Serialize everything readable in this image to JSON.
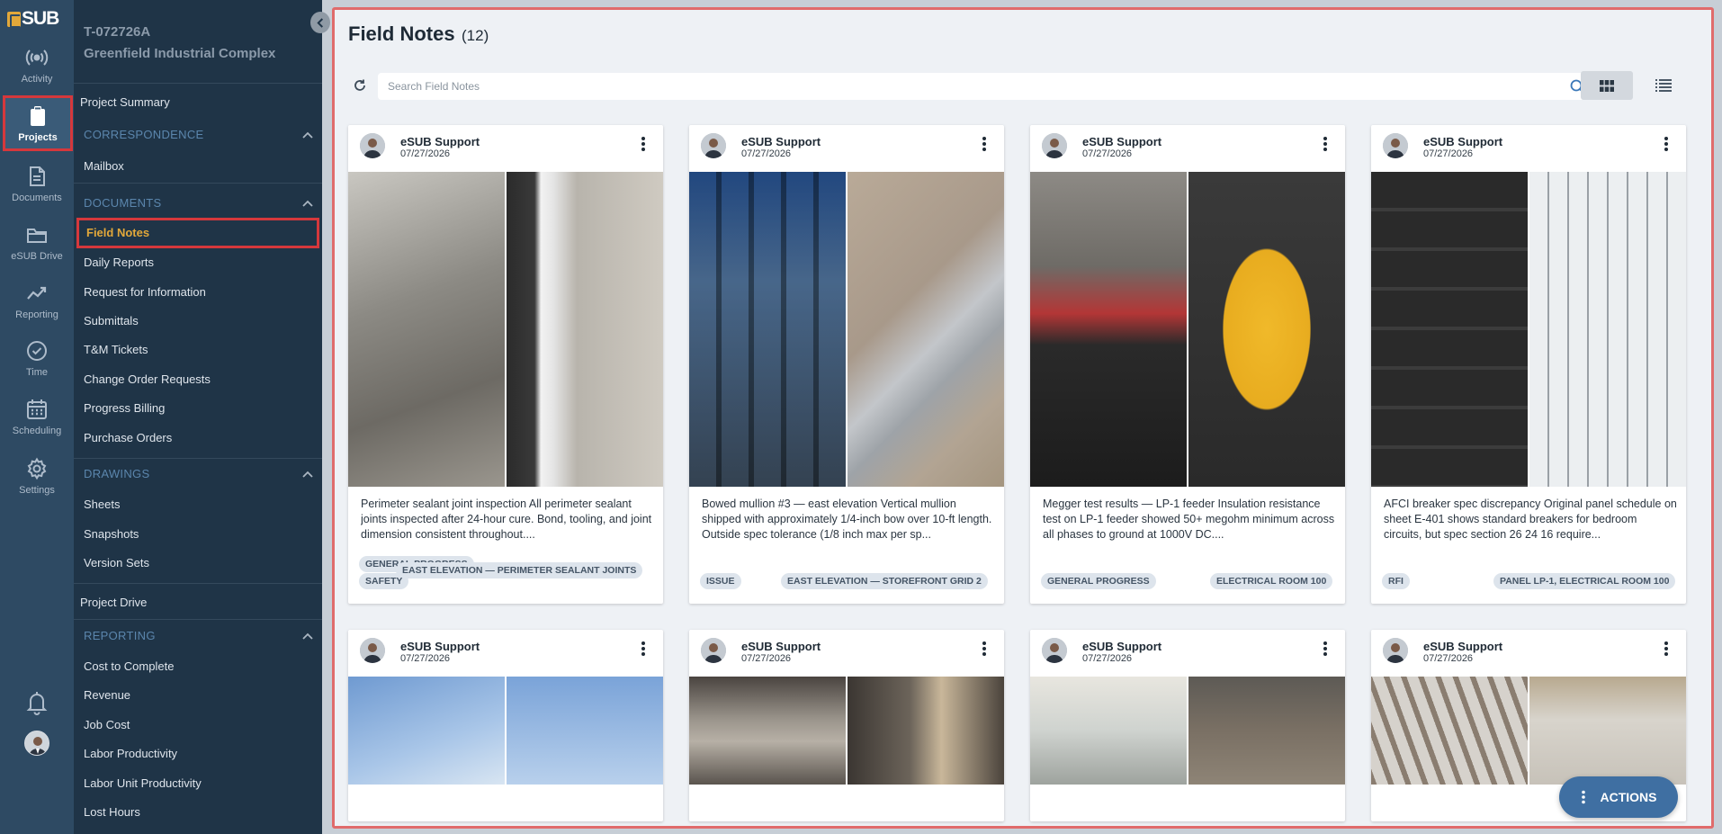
{
  "brand": {
    "logo_text": "SUB"
  },
  "rail": [
    {
      "label": "Activity",
      "icon": "activity-icon"
    },
    {
      "label": "Projects",
      "icon": "clipboard-icon",
      "active": true
    },
    {
      "label": "Documents",
      "icon": "document-icon"
    },
    {
      "label": "eSUB Drive",
      "icon": "folder-icon"
    },
    {
      "label": "Reporting",
      "icon": "trend-icon"
    },
    {
      "label": "Time",
      "icon": "clock-check-icon"
    },
    {
      "label": "Scheduling",
      "icon": "calendar-icon"
    },
    {
      "label": "Settings",
      "icon": "gear-icon"
    }
  ],
  "project": {
    "code": "T-072726A",
    "name": "Greenfield Industrial Complex"
  },
  "nav": {
    "project_summary": "Project Summary",
    "correspondence": {
      "header": "CORRESPONDENCE",
      "items": [
        "Mailbox"
      ]
    },
    "documents": {
      "header": "DOCUMENTS",
      "items": [
        "Field Notes",
        "Daily Reports",
        "Request for Information",
        "Submittals",
        "T&M Tickets",
        "Change Order Requests",
        "Progress Billing",
        "Purchase Orders"
      ],
      "active": "Field Notes"
    },
    "drawings": {
      "header": "DRAWINGS",
      "items": [
        "Sheets",
        "Snapshots",
        "Version Sets"
      ]
    },
    "project_drive": "Project Drive",
    "reporting": {
      "header": "REPORTING",
      "items": [
        "Cost to Complete",
        "Revenue",
        "Job Cost",
        "Labor Productivity",
        "Labor Unit Productivity",
        "Lost Hours"
      ]
    }
  },
  "main": {
    "title": "Field Notes",
    "count": "(12)",
    "search_placeholder": "Search Field Notes",
    "actions_label": "ACTIONS",
    "view_mode": "grid"
  },
  "cards": [
    {
      "author": "eSUB Support",
      "date": "07/27/2026",
      "description": "Perimeter sealant joint inspection All perimeter sealant joints inspected after 24-hour cure. Bond, tooling, and joint dimension consistent throughout....",
      "tags": [
        "GENERAL PROGRESS",
        "EAST ELEVATION — PERIMETER SEALANT JOINTS",
        "SAFETY"
      ],
      "photos": [
        "sealant-caulk-gun",
        "sealant-joint-frame"
      ]
    },
    {
      "author": "eSUB Support",
      "date": "07/27/2026",
      "description": "Bowed mullion #3 — east elevation Vertical mullion shipped with approximately 1/4-inch bow over 10-ft length. Outside spec tolerance (1/8 inch max per sp...",
      "tags": [
        "ISSUE",
        "EAST ELEVATION — STOREFRONT GRID 2"
      ],
      "photos": [
        "storefront-framing",
        "aluminum-mullion"
      ]
    },
    {
      "author": "eSUB Support",
      "date": "07/27/2026",
      "description": "Megger test results — LP-1 feeder Insulation resistance test on LP-1 feeder showed 50+ megohm minimum across all phases to ground at 1000V DC....",
      "tags": [
        "GENERAL PROGRESS",
        "ELECTRICAL ROOM 100"
      ],
      "photos": [
        "feeder-lugs",
        "megger-meter"
      ]
    },
    {
      "author": "eSUB Support",
      "date": "07/27/2026",
      "description": "AFCI breaker spec discrepancy Original panel schedule on sheet E-401 shows standard breakers for bedroom circuits, but spec section 26 24 16 require...",
      "tags": [
        "RFI",
        "PANEL LP-1, ELECTRICAL ROOM 100"
      ],
      "photos": [
        "breaker-panel",
        "afci-breakers"
      ]
    },
    {
      "author": "eSUB Support",
      "date": "07/27/2026",
      "photos": [
        "crane-sky",
        "sky-wires"
      ]
    },
    {
      "author": "eSUB Support",
      "date": "07/27/2026",
      "photos": [
        "concrete-cylinders",
        "test-press"
      ]
    },
    {
      "author": "eSUB Support",
      "date": "07/27/2026",
      "photos": [
        "classroom-desks",
        "site-workers"
      ]
    },
    {
      "author": "eSUB Support",
      "date": "07/27/2026",
      "photos": [
        "rebar-frost",
        "concrete-wall"
      ]
    }
  ],
  "colors": {
    "rail_bg": "#2e4a63",
    "nav_bg": "#1f3447",
    "accent": "#e2a83a",
    "highlight_border": "#d5383c",
    "primary_button": "#3f6fa2"
  }
}
